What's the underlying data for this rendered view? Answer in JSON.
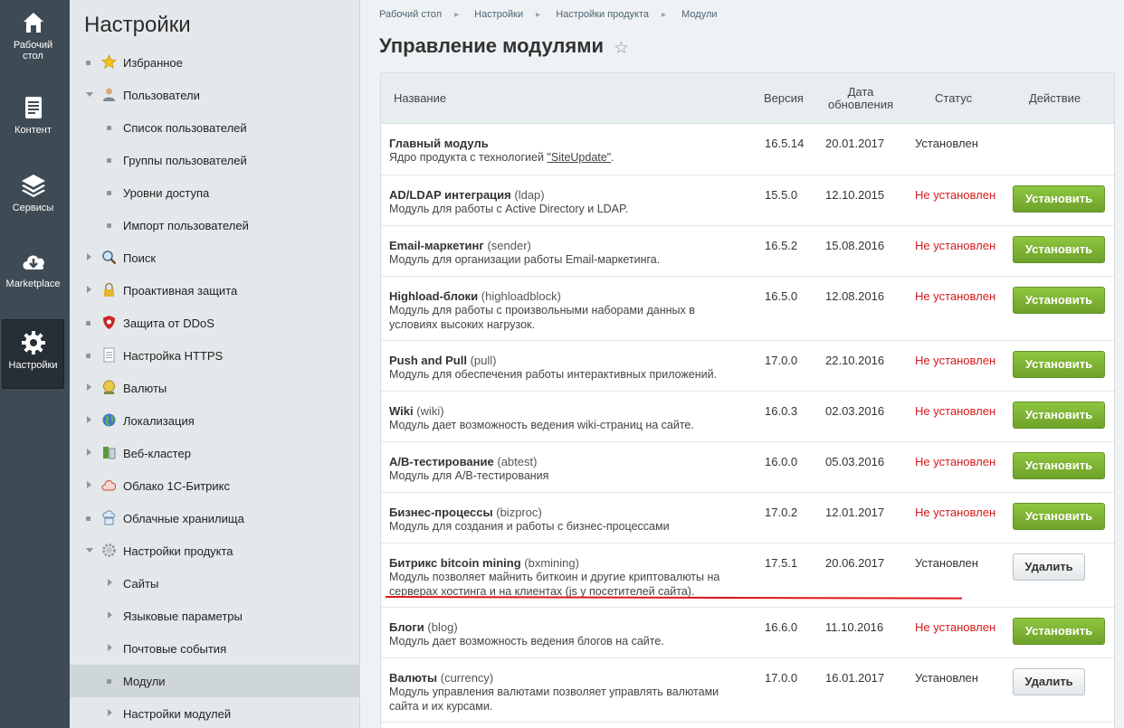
{
  "leftnav": {
    "items": [
      {
        "label": "Рабочий стол",
        "icon": "home-icon"
      },
      {
        "label": "Контент",
        "icon": "document-icon"
      },
      {
        "label": "Сервисы",
        "icon": "layers-icon"
      },
      {
        "label": "Marketplace",
        "icon": "cloud-download-icon"
      },
      {
        "label": "Настройки",
        "icon": "gear-icon",
        "active": true
      }
    ]
  },
  "menu": {
    "title": "Настройки",
    "items": [
      {
        "label": "Избранное",
        "icon": "star-icon"
      },
      {
        "label": "Пользователи",
        "icon": "user-icon"
      },
      {
        "label": "Список пользователей"
      },
      {
        "label": "Группы пользователей"
      },
      {
        "label": "Уровни доступа"
      },
      {
        "label": "Импорт пользователей"
      },
      {
        "label": "Поиск",
        "icon": "magnifier-icon"
      },
      {
        "label": "Проактивная защита",
        "icon": "lock-icon"
      },
      {
        "label": "Защита от DDoS",
        "icon": "shield-icon"
      },
      {
        "label": "Настройка HTTPS",
        "icon": "page-icon"
      },
      {
        "label": "Валюты",
        "icon": "coin-icon"
      },
      {
        "label": "Локализация",
        "icon": "globe-icon"
      },
      {
        "label": "Веб-кластер",
        "icon": "cluster-icon"
      },
      {
        "label": "Облако 1С-Битрикс",
        "icon": "cloud-icon"
      },
      {
        "label": "Облачные хранилища",
        "icon": "storage-icon"
      },
      {
        "label": "Настройки продукта",
        "icon": "cog-icon"
      },
      {
        "label": "Сайты"
      },
      {
        "label": "Языковые параметры"
      },
      {
        "label": "Почтовые события"
      },
      {
        "label": "Модули"
      },
      {
        "label": "Настройки модулей"
      }
    ]
  },
  "breadcrumb": [
    "Рабочий стол",
    "Настройки",
    "Настройки продукта",
    "Модули"
  ],
  "page": {
    "title": "Управление модулями"
  },
  "table": {
    "headers": {
      "name": "Название",
      "version": "Версия",
      "date_line1": "Дата",
      "date_line2": "обновления",
      "status": "Статус",
      "action": "Действие"
    },
    "rows": [
      {
        "title": "Главный модуль",
        "code": "",
        "desc": "Ядро продукта с технологией ",
        "link": "\"SiteUpdate\"",
        "desc_after": ".",
        "version": "16.5.14",
        "date": "20.01.2017",
        "status": "Установлен",
        "installed": true,
        "action": ""
      },
      {
        "title": "AD/LDAP интеграция",
        "code": "(ldap)",
        "desc": "Модуль для работы с Active Directory и LDAP.",
        "version": "15.5.0",
        "date": "12.10.2015",
        "status": "Не установлен",
        "installed": false,
        "action": "Установить"
      },
      {
        "title": "Email-маркетинг",
        "code": "(sender)",
        "desc": "Модуль для организации работы Email-маркетинга.",
        "version": "16.5.2",
        "date": "15.08.2016",
        "status": "Не установлен",
        "installed": false,
        "action": "Установить"
      },
      {
        "title": "Highload-блоки",
        "code": "(highloadblock)",
        "desc": "Модуль для работы с произвольными наборами данных в",
        "desc2": "условиях высоких нагрузок.",
        "version": "16.5.0",
        "date": "12.08.2016",
        "status": "Не установлен",
        "installed": false,
        "action": "Установить"
      },
      {
        "title": "Push and Pull",
        "code": "(pull)",
        "desc": "Модуль для обеспечения работы интерактивных приложений.",
        "version": "17.0.0",
        "date": "22.10.2016",
        "status": "Не установлен",
        "installed": false,
        "action": "Установить"
      },
      {
        "title": "Wiki",
        "code": "(wiki)",
        "desc": "Модуль дает возможность ведения wiki-страниц на сайте.",
        "version": "16.0.3",
        "date": "02.03.2016",
        "status": "Не установлен",
        "installed": false,
        "action": "Установить"
      },
      {
        "title": "A/B-тестирование",
        "code": "(abtest)",
        "desc": "Модуль для A/B-тестирования",
        "version": "16.0.0",
        "date": "05.03.2016",
        "status": "Не установлен",
        "installed": false,
        "action": "Установить"
      },
      {
        "title": "Бизнес-процессы",
        "code": "(bizproc)",
        "desc": "Модуль для создания и работы с бизнес-процессами",
        "version": "17.0.2",
        "date": "12.01.2017",
        "status": "Не установлен",
        "installed": false,
        "action": "Установить"
      },
      {
        "title": "Битрикс bitcoin mining",
        "code": "(bxmining)",
        "desc": "Модуль позволяет майнить биткоин и другие криптовалюты на",
        "desc2": "серверах хостинга и на клиентах (js у посетителей сайта).",
        "version": "17.5.1",
        "date": "20.06.2017",
        "status": "Установлен",
        "installed": true,
        "action": "Удалить"
      },
      {
        "title": "Блоги",
        "code": "(blog)",
        "desc": "Модуль дает возможность ведения блогов на сайте.",
        "version": "16.6.0",
        "date": "11.10.2016",
        "status": "Не установлен",
        "installed": false,
        "action": "Установить"
      },
      {
        "title": "Валюты",
        "code": "(currency)",
        "desc": "Модуль управления валютами позволяет управлять валютами",
        "desc2": "сайта и их курсами.",
        "version": "17.0.0",
        "date": "16.01.2017",
        "status": "Установлен",
        "installed": true,
        "action": "Удалить"
      }
    ]
  },
  "colors": {
    "installButton": "#79b030",
    "notInstalled": "#d71a1a",
    "navBg": "#3f4b54",
    "underline": "#e0151b"
  }
}
